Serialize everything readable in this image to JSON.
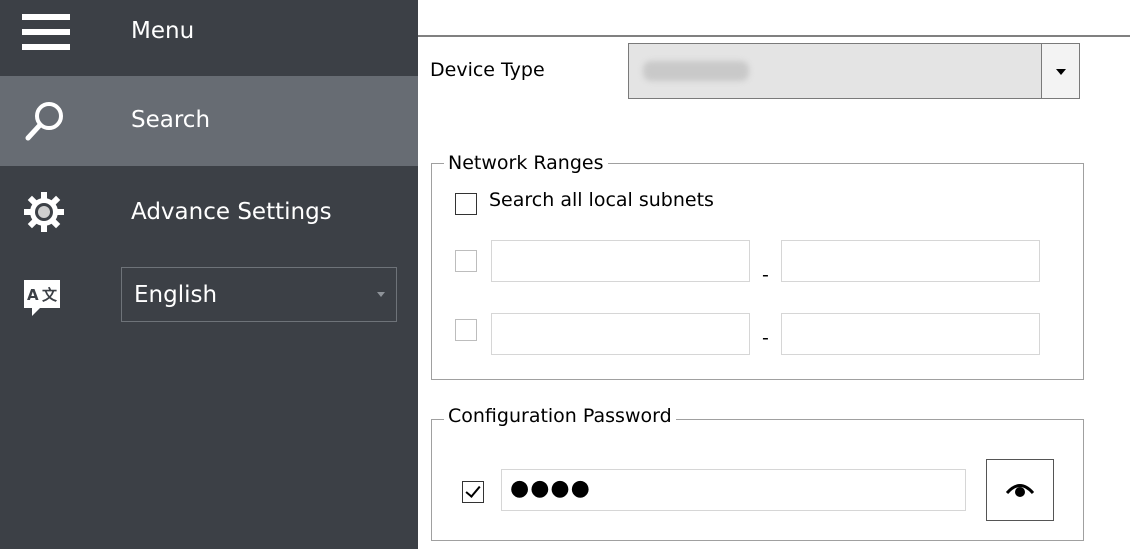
{
  "sidebar": {
    "items": [
      {
        "label": "Menu",
        "icon": "menu-icon"
      },
      {
        "label": "Search",
        "icon": "search-icon",
        "active": true
      },
      {
        "label": "Advance Settings",
        "icon": "gear-icon"
      }
    ],
    "language": {
      "icon": "translate-icon",
      "selected": "English"
    },
    "colors": {
      "background": "#3c4046",
      "active": "#676c73"
    }
  },
  "main": {
    "device_type": {
      "label": "Device Type",
      "value_redacted": true
    },
    "network_ranges": {
      "title": "Network Ranges",
      "search_all_label": "Search all local subnets",
      "search_all_checked": false,
      "ranges": [
        {
          "checked": false,
          "from": "",
          "to": "",
          "separator": "-"
        },
        {
          "checked": false,
          "from": "",
          "to": "",
          "separator": "-"
        }
      ]
    },
    "configuration_password": {
      "title": "Configuration Password",
      "checked": true,
      "masked_value": "●●●●",
      "toggle_icon": "eye-icon"
    }
  }
}
